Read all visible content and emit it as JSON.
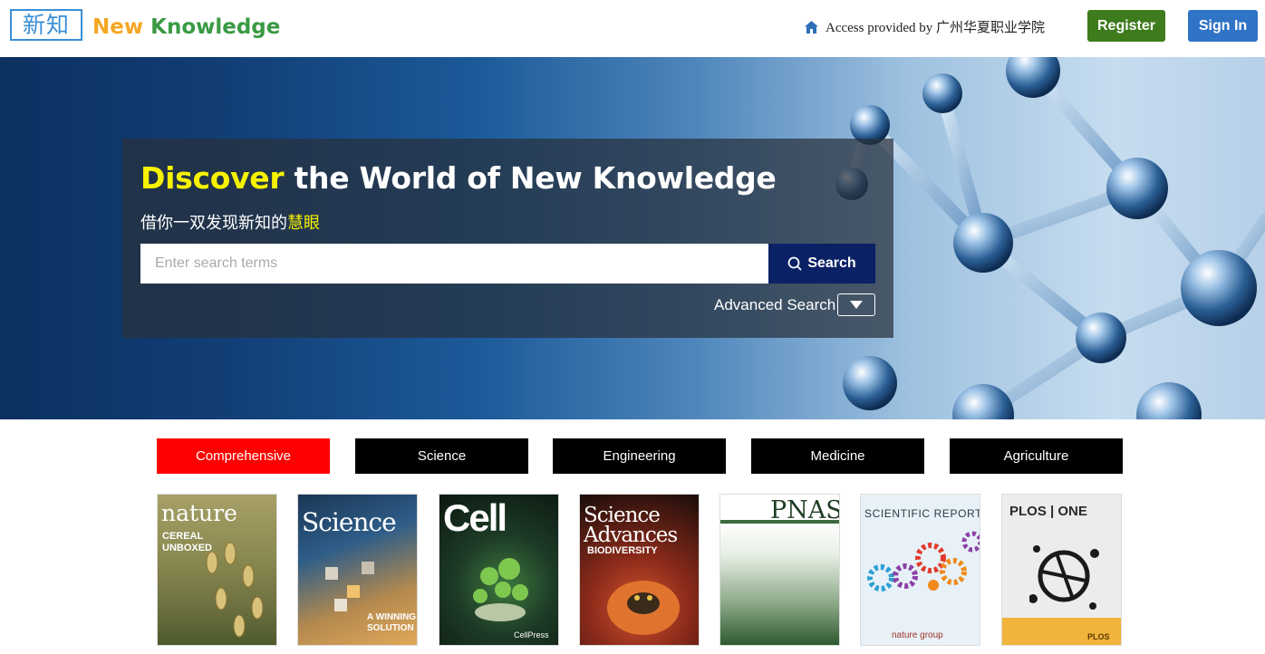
{
  "header": {
    "logo_cn": "新知",
    "logo_en_first": "New",
    "logo_en_rest": " Knowledge",
    "home_icon": "home-icon",
    "access_text": "Access provided by 广州华夏职业学院",
    "register_label": "Register",
    "signin_label": "Sign In",
    "colors": {
      "register": "#3e7b1c",
      "signin": "#2f74c6"
    }
  },
  "hero": {
    "headline_accent": "Discover",
    "headline_rest": " the World of New Knowledge",
    "subline_main": "借你一双发现新知的",
    "subline_accent": "慧眼",
    "search_placeholder": "Enter search terms",
    "search_value": "",
    "search_button_label": "Search",
    "search_icon": "search-icon",
    "advanced_label": "Advanced Search",
    "advanced_icon": "caret-down-icon",
    "accent_color": "#f7f200"
  },
  "tabs": [
    {
      "label": "Comprehensive",
      "active": true
    },
    {
      "label": "Science",
      "active": false
    },
    {
      "label": "Engineering",
      "active": false
    },
    {
      "label": "Medicine",
      "active": false
    },
    {
      "label": "Agriculture",
      "active": false
    }
  ],
  "journals": [
    {
      "title": "nature",
      "cover_text": "CEREAL UNBOXED"
    },
    {
      "title": "Science",
      "cover_text": "A WINNING SOLUTION"
    },
    {
      "title": "Cell",
      "cover_text": "CellPress"
    },
    {
      "title": "Science Advances",
      "cover_text": "BIODIVERSITY"
    },
    {
      "title": "PNAS",
      "cover_text": ""
    },
    {
      "title": "SCIENTIFIC REPORTS",
      "cover_text": "nature group"
    },
    {
      "title": "PLOS | ONE",
      "cover_text": "PLOS"
    }
  ]
}
